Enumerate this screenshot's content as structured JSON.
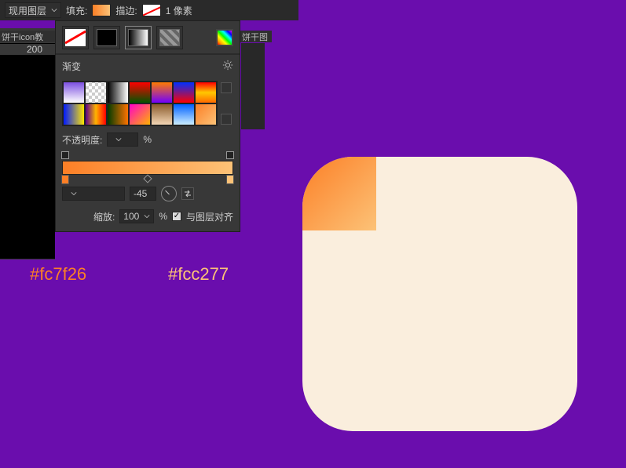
{
  "topbar": {
    "layer_dropdown": "现用图层",
    "fill_label": "填充:",
    "stroke_label": "描边:",
    "stroke_px": "1 像素"
  },
  "tabs": {
    "left": "饼干icon教",
    "right": "饼干图"
  },
  "ruler": {
    "mark": "200"
  },
  "panel": {
    "grad_header": "渐变",
    "opacity_label": "不透明度:",
    "opacity_value": "",
    "opacity_unit": "%",
    "angle_value": "-45",
    "scale_label": "缩放:",
    "scale_value": "100",
    "scale_unit": "%",
    "align_label": "与图层对齐"
  },
  "hex": {
    "c1": "#fc7f26",
    "c2": "#fcc277"
  },
  "icons": {
    "chevron_down": "chevron-down-icon",
    "no_fill": "no-fill-icon",
    "solid": "solid-fill-icon",
    "linear": "linear-gradient-icon",
    "pattern": "pattern-fill-icon",
    "picker": "color-picker-icon",
    "gear": "gear-icon",
    "new": "new-preset-icon",
    "trash": "delete-preset-icon",
    "reverse": "reverse-gradient-icon",
    "check": "checkmark-icon"
  },
  "gradient_presets": [
    "linear-gradient(180deg,#7b4fe0,#fff)",
    "repeating-conic-gradient(#ccc 0 25%,#fff 0 50%) 0/8px 8px",
    "linear-gradient(90deg,#000,#fff)",
    "linear-gradient(180deg,#ff0000,#005500)",
    "linear-gradient(180deg,#ff7b00,#7000ff)",
    "linear-gradient(180deg,#0030ff,#ff0000)",
    "linear-gradient(180deg,#ff0000,#ffc800,#ff6a00)",
    "linear-gradient(90deg,#001aff,#ffe600)",
    "linear-gradient(90deg,#5a008a,#ffb300,#ff0000)",
    "linear-gradient(90deg,#003a00,#ff7300)",
    "linear-gradient(135deg,#ff00c8,#ffb300)",
    "linear-gradient(180deg,#8a5a2b,#f3d6b5)",
    "linear-gradient(180deg,#0060ff,#cceeff)",
    "linear-gradient(135deg,#fc7f26,#fcc277)"
  ]
}
